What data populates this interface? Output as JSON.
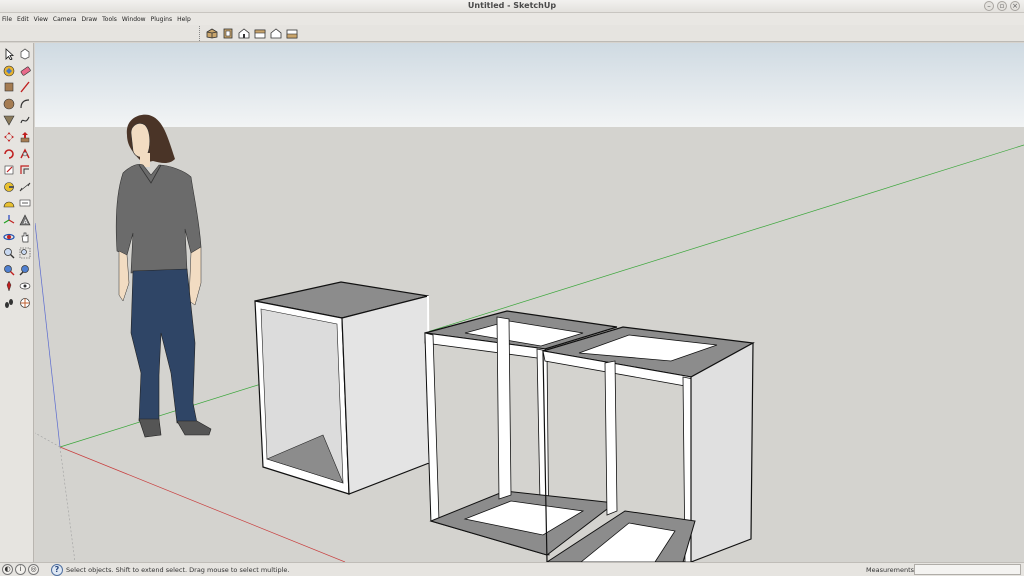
{
  "window": {
    "title": "Untitled - SketchUp",
    "controls": [
      "minimize",
      "maximize",
      "close"
    ]
  },
  "menu": [
    "File",
    "Edit",
    "View",
    "Camera",
    "Draw",
    "Tools",
    "Window",
    "Plugins",
    "Help"
  ],
  "views_toolbar": [
    {
      "icon": "iso-view-icon"
    },
    {
      "icon": "top-view-icon"
    },
    {
      "icon": "front-view-icon"
    },
    {
      "icon": "right-view-icon"
    },
    {
      "icon": "back-view-icon"
    },
    {
      "icon": "left-view-icon"
    }
  ],
  "large_toolset": [
    "select-icon",
    "make-component-icon",
    "paint-bucket-icon",
    "eraser-icon",
    "rectangle-icon",
    "line-icon",
    "circle-icon",
    "arc-icon",
    "polygon-icon",
    "freehand-icon",
    "move-icon",
    "push-pull-icon",
    "rotate-icon",
    "follow-me-icon",
    "scale-icon",
    "offset-icon",
    "tape-measure-icon",
    "dimension-icon",
    "protractor-icon",
    "text-icon",
    "axes-icon",
    "3d-text-icon",
    "orbit-icon",
    "pan-icon",
    "zoom-icon",
    "zoom-window-icon",
    "zoom-extents-icon",
    "previous-view-icon",
    "position-camera-icon",
    "look-around-icon",
    "walk-icon",
    "section-plane-icon"
  ],
  "colors": {
    "sky_top": "#cfdae2",
    "sky_bottom": "#f2f4f5",
    "ground": "#d4d3cf",
    "axis_green": "#3aa63a",
    "axis_red": "#c84040",
    "axis_blue": "#5a6ad0",
    "face_light": "#e0e0e0",
    "face_dark": "#8e8e8e"
  },
  "status": {
    "text": "Select objects. Shift to extend select. Drag mouse to select multiple.",
    "measurements_label": "Measurements",
    "measurements_value": ""
  }
}
